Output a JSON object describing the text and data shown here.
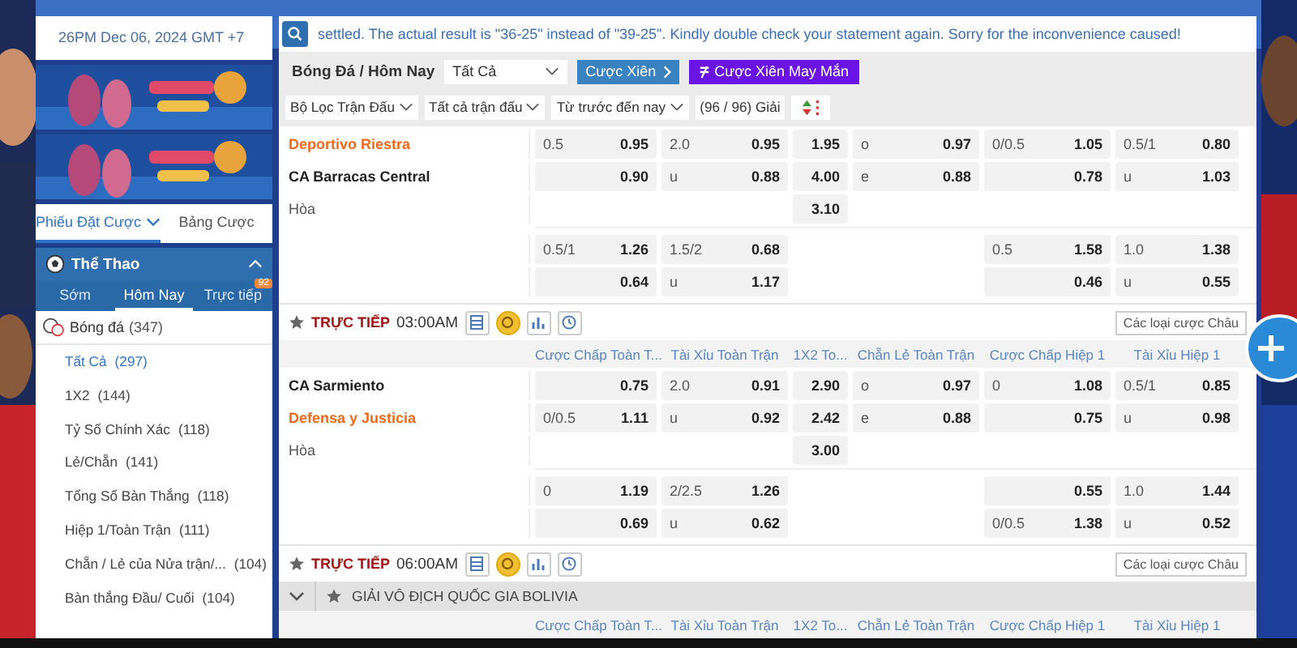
{
  "sidebar": {
    "time": "26PM Dec 06, 2024 GMT +7",
    "tabs": [
      {
        "label": "Phiếu Đặt Cược",
        "selected": true
      },
      {
        "label": "Bảng Cược",
        "selected": false
      }
    ],
    "sports_panel": {
      "title": "Thể Thao",
      "expanded": true,
      "tabs": [
        {
          "label": "Sớm",
          "selected": false
        },
        {
          "label": "Hôm Nay",
          "selected": true
        },
        {
          "label": "Trực tiếp",
          "selected": false,
          "badge": "92"
        }
      ],
      "sport": {
        "label": "Bóng đá",
        "count": "(347)",
        "children": [
          {
            "label": "Tất Cả",
            "count": "(297)",
            "selected": true
          },
          {
            "label": "1X2",
            "count": "(144)",
            "selected": false
          },
          {
            "label": "Tỷ Số Chính Xác",
            "count": "(118)",
            "selected": false
          },
          {
            "label": "Lẻ/Chẵn",
            "count": "(141)",
            "selected": false
          },
          {
            "label": "Tổng Số Bàn Thắng",
            "count": "(118)",
            "selected": false
          },
          {
            "label": "Hiệp 1/Toàn Trận",
            "count": "(111)",
            "selected": false
          },
          {
            "label": "Chẵn / Lẻ của Nửa trận/...",
            "count": "(104)",
            "selected": false
          },
          {
            "label": "Bàn thắng Đầu/ Cuối",
            "count": "(104)",
            "selected": false
          }
        ]
      }
    }
  },
  "notice": "settled. The actual result is \"36-25\" instead of \"39-25\". Kindly double check your statement again. Sorry for the inconvenience caused!",
  "header": {
    "breadcrumb": "Bóng Đá / Hôm Nay",
    "market_select": "Tất Cả",
    "parlay_button": "Cược Xiên",
    "lucky_button": "Cược Xiên May Mắn"
  },
  "filters": [
    {
      "label": "Bộ Lọc Trận Đấu"
    },
    {
      "label": "Tất cả trận đấu"
    },
    {
      "label": "Từ trước đến nay"
    }
  ],
  "league_count": "(96 / 96) Giải",
  "blocks": [
    {
      "kind": "match",
      "main": [
        {
          "team": "Deportivo Riestra",
          "highlighted": true,
          "cells": [
            {
              "line": "0.5",
              "price": "0.95"
            },
            {
              "line": "2.0",
              "price": "0.95"
            },
            {
              "price": "1.95"
            },
            {
              "line": "o",
              "price": "0.97"
            },
            {
              "line": "0/0.5",
              "price": "1.05"
            },
            {
              "line": "0.5/1",
              "price": "0.80"
            }
          ]
        },
        {
          "team": "CA Barracas Central",
          "highlighted": false,
          "cells": [
            {
              "price": "0.90"
            },
            {
              "line": "u",
              "price": "0.88"
            },
            {
              "price": "4.00"
            },
            {
              "line": "e",
              "price": "0.88"
            },
            {
              "price": "0.78"
            },
            {
              "line": "u",
              "price": "1.03"
            }
          ]
        },
        {
          "team": "Hòa",
          "kind": "draw",
          "cells": [
            null,
            null,
            {
              "price": "3.10"
            },
            null,
            null,
            null
          ]
        }
      ],
      "extra": [
        {
          "cells": [
            {
              "line": "0.5/1",
              "price": "1.26"
            },
            {
              "line": "1.5/2",
              "price": "0.68"
            },
            null,
            null,
            {
              "line": "0.5",
              "price": "1.58"
            },
            {
              "line": "1.0",
              "price": "1.38"
            }
          ]
        },
        {
          "cells": [
            {
              "price": "0.64"
            },
            {
              "line": "u",
              "price": "1.17"
            },
            null,
            null,
            {
              "price": "0.46"
            },
            {
              "line": "u",
              "price": "0.55"
            }
          ]
        }
      ]
    },
    {
      "kind": "section",
      "live": "TRỰC TIẾP",
      "time": "03:00AM",
      "odds_button": "Các loại cược Châu"
    },
    {
      "kind": "columns",
      "labels": [
        "Cược Chấp Toàn T...",
        "Tài Xỉu Toàn Trận",
        "1X2 To...",
        "Chẵn Lẻ Toàn Trận",
        "Cược Chấp Hiệp 1",
        "Tài Xỉu Hiệp 1"
      ]
    },
    {
      "kind": "match",
      "main": [
        {
          "team": "CA Sarmiento",
          "highlighted": false,
          "cells": [
            {
              "price": "0.75"
            },
            {
              "line": "2.0",
              "price": "0.91"
            },
            {
              "price": "2.90"
            },
            {
              "line": "o",
              "price": "0.97"
            },
            {
              "line": "0",
              "price": "1.08"
            },
            {
              "line": "0.5/1",
              "price": "0.85"
            }
          ]
        },
        {
          "team": "Defensa y Justicia",
          "highlighted": true,
          "cells": [
            {
              "line": "0/0.5",
              "price": "1.11"
            },
            {
              "line": "u",
              "price": "0.92"
            },
            {
              "price": "2.42"
            },
            {
              "line": "e",
              "price": "0.88"
            },
            {
              "price": "0.75"
            },
            {
              "line": "u",
              "price": "0.98"
            }
          ]
        },
        {
          "team": "Hòa",
          "kind": "draw",
          "cells": [
            null,
            null,
            {
              "price": "3.00"
            },
            null,
            null,
            null
          ]
        }
      ],
      "extra": [
        {
          "cells": [
            {
              "line": "0",
              "price": "1.19"
            },
            {
              "line": "2/2.5",
              "price": "1.26"
            },
            null,
            null,
            {
              "price": "0.55"
            },
            {
              "line": "1.0",
              "price": "1.44"
            }
          ]
        },
        {
          "cells": [
            {
              "price": "0.69"
            },
            {
              "line": "u",
              "price": "0.62"
            },
            null,
            null,
            {
              "line": "0/0.5",
              "price": "1.38"
            },
            {
              "line": "u",
              "price": "0.52"
            }
          ]
        }
      ]
    },
    {
      "kind": "section",
      "live": "TRỰC TIẾP",
      "time": "06:00AM",
      "odds_button": "Các loại cược Châu"
    },
    {
      "kind": "league",
      "name": "GIẢI VÔ ĐỊCH QUỐC GIA BOLIVIA",
      "expanded": true
    },
    {
      "kind": "columns",
      "labels": [
        "Cược Chấp Toàn T...",
        "Tài Xỉu Toàn Trận",
        "1X2 To...",
        "Chẵn Lẻ Toàn Trận",
        "Cược Chấp Hiệp 1",
        "Tài Xỉu Hiệp 1"
      ]
    }
  ]
}
